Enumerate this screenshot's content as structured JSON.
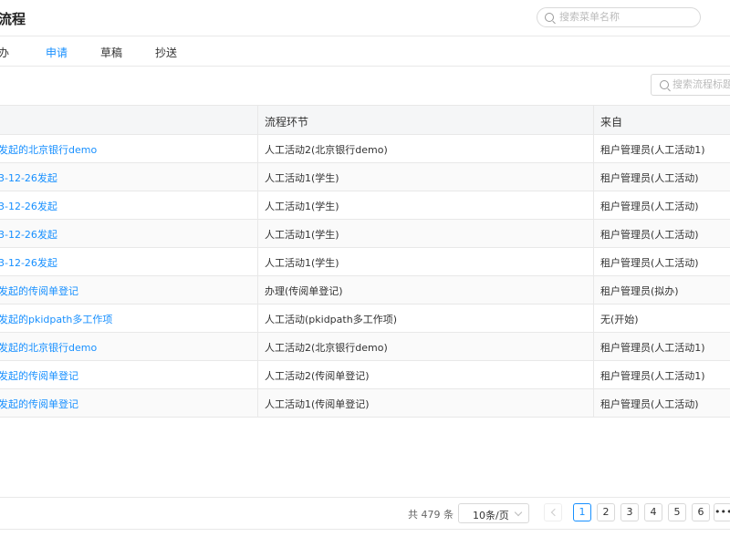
{
  "header": {
    "title": "流程",
    "search_placeholder": "搜索菜单名称"
  },
  "tabs": [
    {
      "label": "办",
      "active": false
    },
    {
      "label": "申请",
      "active": true
    },
    {
      "label": "草稿",
      "active": false
    },
    {
      "label": "抄送",
      "active": false
    }
  ],
  "filter": {
    "placeholder": "搜索流程标题"
  },
  "table": {
    "headers": [
      "流程环节",
      "来自"
    ],
    "rows": [
      {
        "title": "发起的北京银行demo",
        "stage": "人工活动2(北京银行demo)",
        "from": "租户管理员(人工活动1)"
      },
      {
        "title": "3-12-26发起",
        "stage": "人工活动1(学生)",
        "from": "租户管理员(人工活动)"
      },
      {
        "title": "3-12-26发起",
        "stage": "人工活动1(学生)",
        "from": "租户管理员(人工活动)"
      },
      {
        "title": "3-12-26发起",
        "stage": "人工活动1(学生)",
        "from": "租户管理员(人工活动)"
      },
      {
        "title": "3-12-26发起",
        "stage": "人工活动1(学生)",
        "from": "租户管理员(人工活动)"
      },
      {
        "title": "发起的传阅单登记",
        "stage": "办理(传阅单登记)",
        "from": "租户管理员(拟办)"
      },
      {
        "title": "发起的pkidpath多工作项",
        "stage": "人工活动(pkidpath多工作项)",
        "from": "无(开始)"
      },
      {
        "title": "发起的北京银行demo",
        "stage": "人工活动2(北京银行demo)",
        "from": "租户管理员(人工活动1)"
      },
      {
        "title": "发起的传阅单登记",
        "stage": "人工活动2(传阅单登记)",
        "from": "租户管理员(人工活动1)"
      },
      {
        "title": "发起的传阅单登记",
        "stage": "人工活动1(传阅单登记)",
        "from": "租户管理员(人工活动)"
      }
    ]
  },
  "pagination": {
    "total_text": "共 479 条",
    "page_size": "10条/页",
    "pages": [
      "1",
      "2",
      "3",
      "4",
      "5",
      "6"
    ],
    "current": "1",
    "more": "•••"
  }
}
